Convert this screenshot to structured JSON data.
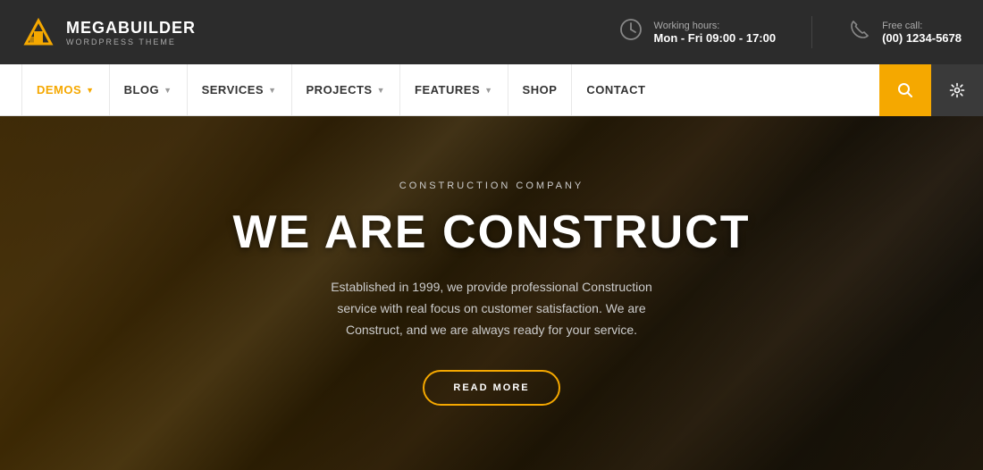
{
  "topbar": {
    "logo_title": "MEGABUILDER",
    "logo_subtitle": "WORDPRESS THEME",
    "working_label": "Working hours:",
    "working_value": "Mon - Fri 09:00 - 17:00",
    "phone_label": "Free call:",
    "phone_value": "(00) 1234-5678"
  },
  "nav": {
    "items": [
      {
        "label": "DEMOS",
        "has_dropdown": true,
        "active": true
      },
      {
        "label": "BLOG",
        "has_dropdown": true,
        "active": false
      },
      {
        "label": "SERVICES",
        "has_dropdown": true,
        "active": false
      },
      {
        "label": "PROJECTS",
        "has_dropdown": true,
        "active": false
      },
      {
        "label": "FEATURES",
        "has_dropdown": true,
        "active": false
      },
      {
        "label": "SHOP",
        "has_dropdown": false,
        "active": false
      },
      {
        "label": "CONTACT",
        "has_dropdown": false,
        "active": false
      }
    ],
    "search_icon": "🔍",
    "settings_icon": "⚙"
  },
  "hero": {
    "eyebrow": "CONSTRUCTION COMPANY",
    "title": "WE ARE CONSTRUCT",
    "description": "Established in 1999, we provide professional Construction service with real focus on customer satisfaction. We are Construct, and we are always ready for your service.",
    "button_label": "READ MORE"
  }
}
